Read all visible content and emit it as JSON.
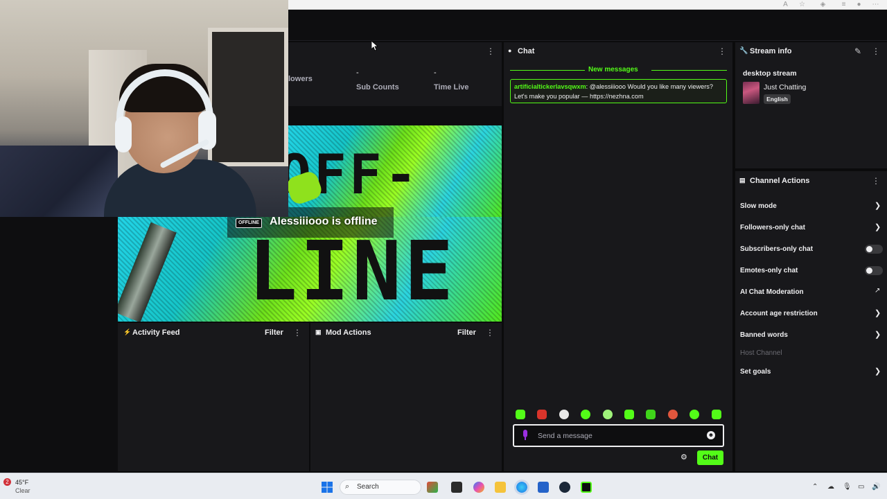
{
  "stats": [
    {
      "value": "",
      "label": "lowers"
    },
    {
      "value": "-",
      "label": "Sub Counts"
    },
    {
      "value": "-",
      "label": "Time Live"
    }
  ],
  "preview": {
    "badge": "OFFLINE",
    "status": "Alessiiiooo is offline",
    "art_top": "OFF-",
    "art_bottom": "LINE"
  },
  "activity": {
    "title": "Activity Feed",
    "filter": "Filter"
  },
  "mod_actions": {
    "title": "Mod Actions",
    "filter": "Filter"
  },
  "chat": {
    "title": "Chat",
    "new_messages": "New messages",
    "message": {
      "user": "artificialtickerlavsqwxm",
      "text": ": @alessiiiooo Would you like many viewers? Let's make you popular — https://nezhna.com"
    },
    "input_placeholder": "Send a message",
    "send_label": "Chat",
    "accent": "#53fc18"
  },
  "stream_info": {
    "title": "Stream info",
    "stream_title": "desktop stream",
    "category": "Just Chatting",
    "language": "English"
  },
  "channel_actions": {
    "title": "Channel Actions",
    "items": [
      {
        "label": "Slow mode",
        "control": "chevron"
      },
      {
        "label": "Followers-only chat",
        "control": "chevron"
      },
      {
        "label": "Subscribers-only chat",
        "control": "toggle",
        "on": false
      },
      {
        "label": "Emotes-only chat",
        "control": "toggle",
        "on": false
      },
      {
        "label": "AI Chat Moderation",
        "control": "external"
      },
      {
        "label": "Account age restriction",
        "control": "chevron"
      },
      {
        "label": "Banned words",
        "control": "chevron"
      },
      {
        "label": "Host Channel",
        "control": "none",
        "disabled": true
      },
      {
        "label": "Set goals",
        "control": "chevron"
      }
    ]
  },
  "taskbar": {
    "temperature": "45°F",
    "condition": "Clear",
    "badge_count": "2",
    "search_label": "Search"
  }
}
